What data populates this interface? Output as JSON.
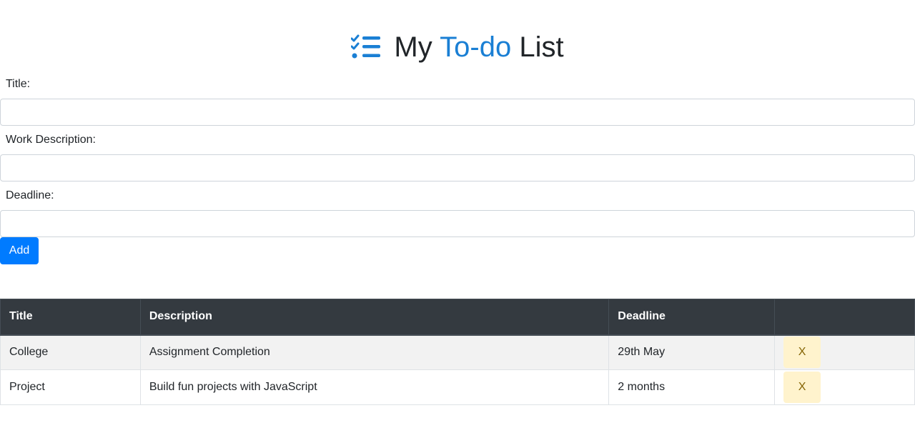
{
  "colors": {
    "accent": "#1a7fd4",
    "primary": "#007bff",
    "table_header_bg": "#343a40",
    "delete_bg": "#fff3cd"
  },
  "header": {
    "icon": "checklist-icon",
    "title_part1": "My ",
    "title_accent": "To-do",
    "title_part2": " List"
  },
  "form": {
    "title_label": "Title:",
    "title_value": "",
    "description_label": "Work Description:",
    "description_value": "",
    "deadline_label": "Deadline:",
    "deadline_value": "",
    "add_label": "Add"
  },
  "table": {
    "headers": [
      "Title",
      "Description",
      "Deadline",
      ""
    ],
    "rows": [
      {
        "title": "College",
        "description": "Assignment Completion",
        "deadline": "29th May",
        "action": "X"
      },
      {
        "title": "Project",
        "description": "Build fun projects with JavaScript",
        "deadline": "2 months",
        "action": "X"
      }
    ]
  }
}
